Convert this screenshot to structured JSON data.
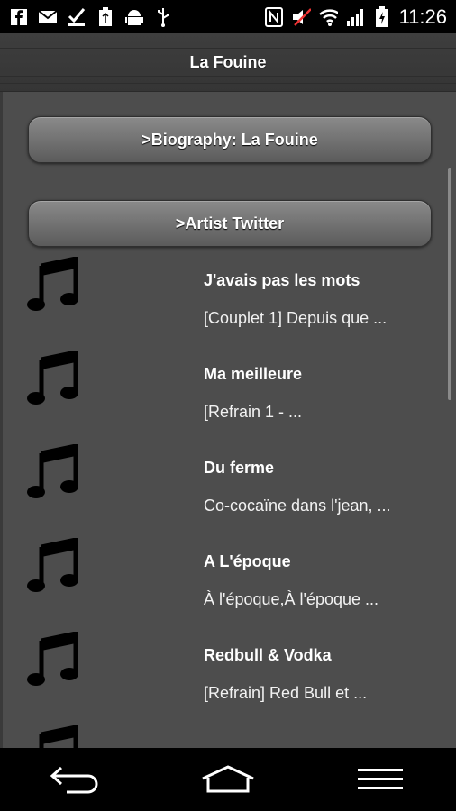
{
  "status_bar": {
    "time": "11:26",
    "icons_left": [
      "facebook-icon",
      "gmail-icon",
      "checkmark-icon",
      "usb-storage-icon",
      "android-debug-icon",
      "usb-icon"
    ],
    "icons_right": [
      "nfc-icon",
      "mute-icon",
      "wifi-icon",
      "signal-icon",
      "battery-charging-icon"
    ]
  },
  "header": {
    "title": "La Fouine"
  },
  "buttons": {
    "biography": ">Biography: La Fouine",
    "twitter": ">Artist Twitter"
  },
  "songs": [
    {
      "title": "J'avais pas les mots",
      "snippet": "[Couplet 1] Depuis que ..."
    },
    {
      "title": "Ma meilleure",
      "snippet": "[Refrain 1 - ..."
    },
    {
      "title": "Du ferme",
      "snippet": "Co-cocaïne dans l'jean, ..."
    },
    {
      "title": "A L'époque",
      "snippet": "À l'époque,À l'époque ..."
    },
    {
      "title": "Redbull & Vodka",
      "snippet": "[Refrain] Red Bull et ..."
    }
  ],
  "colors": {
    "background": "#4d4d4d",
    "bar": "#000000",
    "text": "#ffffff"
  }
}
